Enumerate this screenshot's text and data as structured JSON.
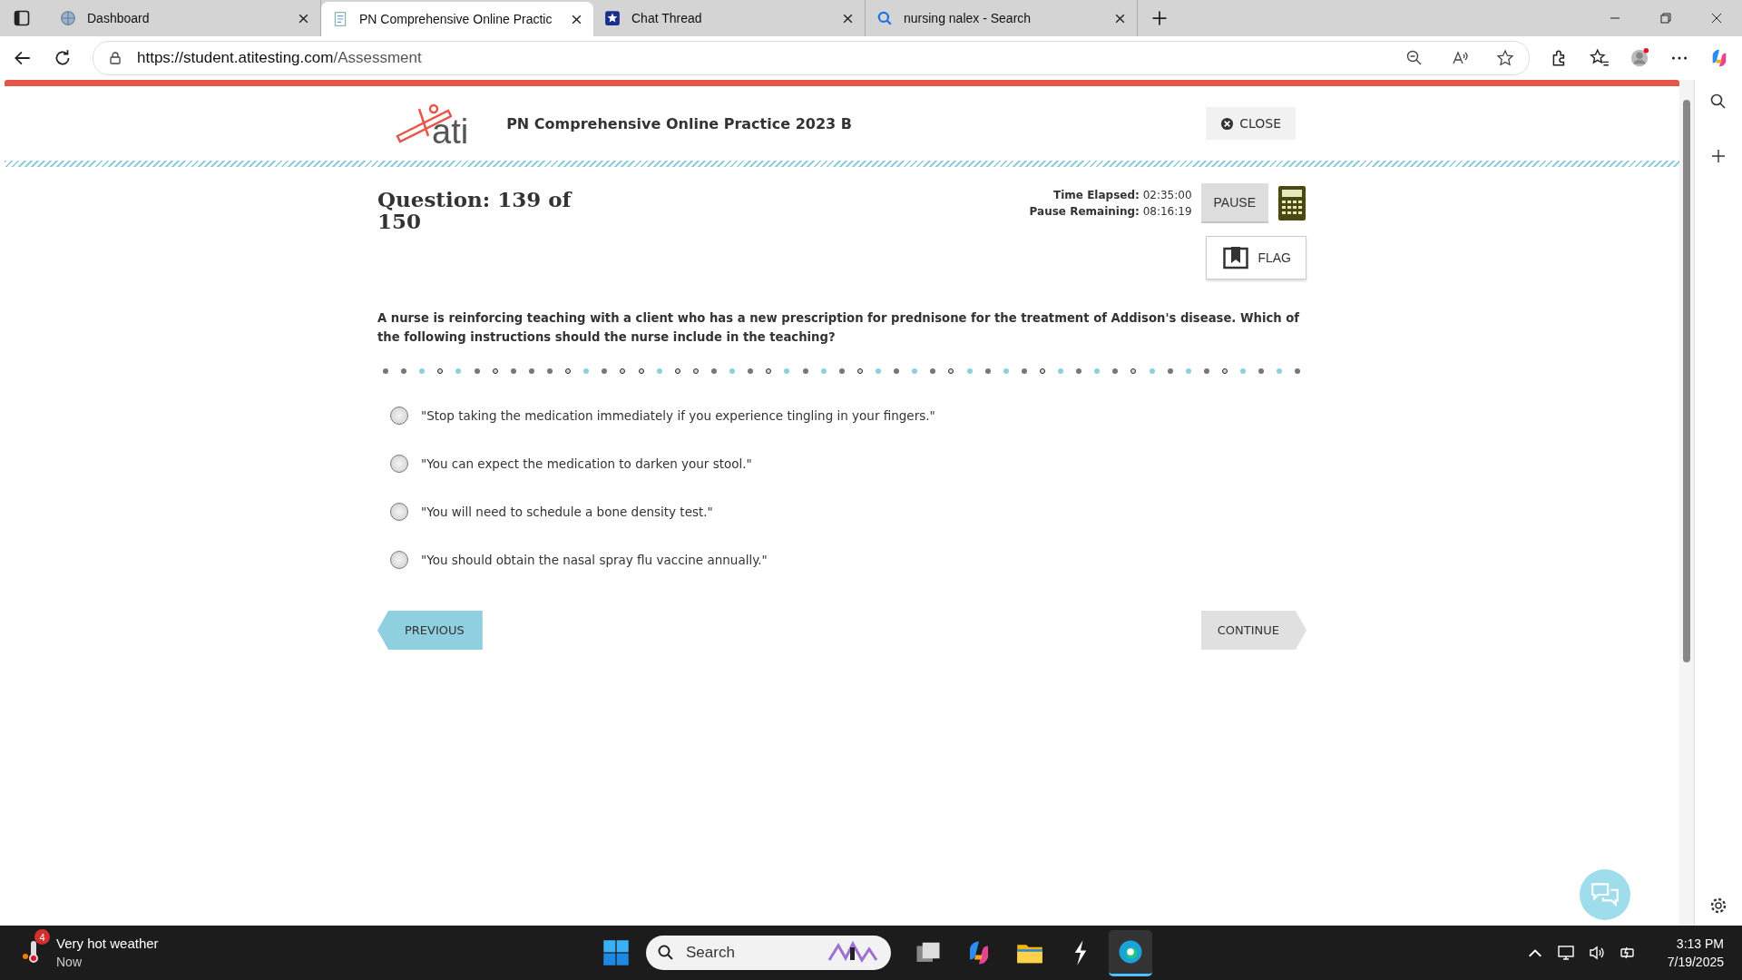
{
  "browser": {
    "tabs": [
      {
        "title": "Dashboard",
        "selected": false
      },
      {
        "title": "PN Comprehensive Online Practic",
        "selected": true
      },
      {
        "title": "Chat Thread",
        "selected": false
      },
      {
        "title": "nursing nalex - Search",
        "selected": false
      }
    ],
    "url_host": "https://student.atitesting.com",
    "url_path": "/Assessment"
  },
  "header": {
    "logo_text": "ati",
    "title": "PN Comprehensive Online Practice 2023 B",
    "close_label": "CLOSE"
  },
  "question": {
    "heading": "Question: 139 of 150",
    "time_elapsed_label": "Time Elapsed:",
    "time_elapsed": "02:35:00",
    "pause_remaining_label": "Pause Remaining:",
    "pause_remaining": "08:16:19",
    "pause_label": "PAUSE",
    "flag_label": "FLAG",
    "stem": "A nurse is reinforcing teaching with a client who has a new prescription for prednisone for the treatment of Addison's disease. Which of the following instructions should the nurse include in the teaching?",
    "progress": [
      {
        "kind": "dark"
      },
      {
        "kind": "dark"
      },
      {
        "kind": "light"
      },
      {
        "kind": "ring"
      },
      {
        "kind": "light"
      },
      {
        "kind": "dark"
      },
      {
        "kind": "ring"
      },
      {
        "kind": "dark"
      },
      {
        "kind": "dark"
      },
      {
        "kind": "dark"
      },
      {
        "kind": "ring"
      },
      {
        "kind": "light"
      },
      {
        "kind": "dark"
      },
      {
        "kind": "ring"
      },
      {
        "kind": "ring"
      },
      {
        "kind": "light"
      },
      {
        "kind": "ring"
      },
      {
        "kind": "ring"
      },
      {
        "kind": "dark"
      },
      {
        "kind": "light"
      },
      {
        "kind": "dark"
      },
      {
        "kind": "ring"
      },
      {
        "kind": "light"
      },
      {
        "kind": "dark"
      },
      {
        "kind": "light"
      },
      {
        "kind": "dark"
      },
      {
        "kind": "ring"
      },
      {
        "kind": "light"
      },
      {
        "kind": "dark"
      },
      {
        "kind": "light"
      },
      {
        "kind": "dark"
      },
      {
        "kind": "ring"
      },
      {
        "kind": "light"
      },
      {
        "kind": "dark"
      },
      {
        "kind": "light"
      },
      {
        "kind": "dark"
      },
      {
        "kind": "ring"
      },
      {
        "kind": "light"
      },
      {
        "kind": "dark"
      },
      {
        "kind": "light"
      },
      {
        "kind": "dark"
      },
      {
        "kind": "ring"
      },
      {
        "kind": "light"
      },
      {
        "kind": "dark"
      },
      {
        "kind": "light"
      },
      {
        "kind": "dark"
      },
      {
        "kind": "ring"
      },
      {
        "kind": "light"
      },
      {
        "kind": "dark"
      },
      {
        "kind": "light"
      },
      {
        "kind": "dark"
      }
    ],
    "options": [
      {
        "text": "\"Stop taking the medication immediately if you experience tingling in your fingers.\"",
        "selected": false
      },
      {
        "text": "\"You can expect the medication to darken your stool.\"",
        "selected": false
      },
      {
        "text": "\"You will need to schedule a bone density test.\"",
        "selected": false
      },
      {
        "text": "\"You should obtain the nasal spray flu vaccine annually.\"",
        "selected": false
      }
    ],
    "previous_label": "PREVIOUS",
    "continue_label": "CONTINUE"
  },
  "taskbar": {
    "weather_badge": "4",
    "weather_title": "Very hot weather",
    "weather_sub": "Now",
    "search_placeholder": "Search",
    "time": "3:13 PM",
    "date": "7/19/2025"
  }
}
